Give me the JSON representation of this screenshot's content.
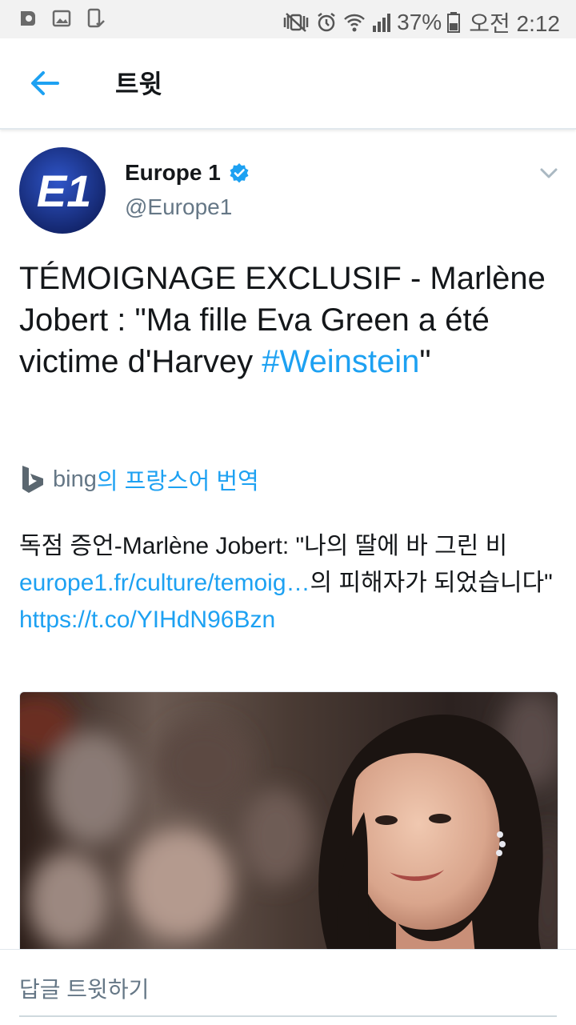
{
  "status_bar": {
    "battery": "37%",
    "time": "오전 2:12",
    "icons": [
      "app-notification-icon",
      "gallery-icon",
      "device-check-icon",
      "vibrate-mute-icon",
      "alarm-icon",
      "wifi-icon",
      "signal-icon",
      "battery-icon"
    ]
  },
  "app_bar": {
    "title": "트윗",
    "back_icon": "arrow-left-icon"
  },
  "tweet": {
    "author_name": "Europe 1",
    "verified": true,
    "handle": "@Europe1",
    "avatar_text": "E1",
    "text_main": "TÉMOIGNAGE EXCLUSIF - Marlène Jobert : \"Ma fille Eva Green a été victime d'Harvey ",
    "hashtag": "#Weinstein",
    "text_end": "\"",
    "translate": {
      "provider": "bing",
      "link_label": "의 프랑스어 번역"
    },
    "translation": {
      "part1": "독점 증언-Marlène Jobert: \"나의 딸에 바 그린 비 ",
      "link1": "europe1.fr/culture/temoig…",
      "part2": "의 피해자가 되었습니다\" ",
      "link2": "https://t.co/YIHdN96Bzn"
    }
  },
  "reply": {
    "placeholder": "답글 트윗하기"
  },
  "colors": {
    "accent": "#1da1f2",
    "text": "#14171a",
    "secondary": "#657786",
    "avatar_bg": "#1a2f7a"
  }
}
